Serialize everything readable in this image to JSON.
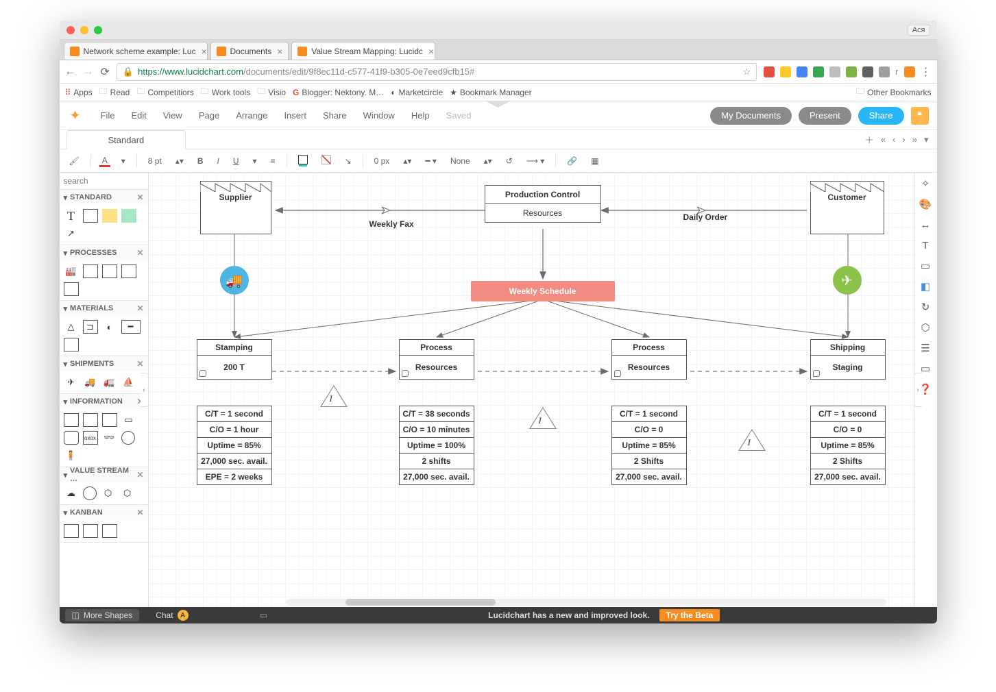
{
  "browser": {
    "user_badge": "Ася",
    "tabs": [
      {
        "title": "Network scheme example: Luc",
        "active": false
      },
      {
        "title": "Documents",
        "active": false
      },
      {
        "title": "Value Stream Mapping: Lucidc",
        "active": true
      }
    ],
    "url_secure": "https://www.lucidchart.com",
    "url_path": "/documents/edit/9f8ec11d-c577-41f9-b305-0e7eed9cfb15#",
    "bookmarks": [
      "Apps",
      "Read",
      "Competitiors",
      "Work tools",
      "Visio",
      "Blogger: Nektony. M…",
      "Marketcircle",
      "Bookmark Manager"
    ],
    "other_bookmarks": "Other Bookmarks"
  },
  "app": {
    "menu": [
      "File",
      "Edit",
      "View",
      "Page",
      "Arrange",
      "Insert",
      "Share",
      "Window",
      "Help"
    ],
    "saved": "Saved",
    "buttons": {
      "docs": "My Documents",
      "present": "Present",
      "share": "Share"
    },
    "doc_tab": "Standard",
    "toolbar": {
      "font_size": "8 pt",
      "line_width": "0 px",
      "line_style": "None"
    },
    "search_placeholder": "search"
  },
  "sidebar": {
    "sections": [
      {
        "name": "STANDARD"
      },
      {
        "name": "PROCESSES"
      },
      {
        "name": "MATERIALS"
      },
      {
        "name": "SHIPMENTS"
      },
      {
        "name": "INFORMATION"
      },
      {
        "name": "VALUE STREAM …"
      },
      {
        "name": "KANBAN"
      }
    ],
    "more_shapes": "More Shapes"
  },
  "status": {
    "chat": "Chat",
    "banner": "Lucidchart has a new and improved look.",
    "beta": "Try the Beta"
  },
  "diagram": {
    "supplier": "Supplier",
    "customer": "Customer",
    "prodctrl": {
      "title": "Production Control",
      "sub": "Resources"
    },
    "weekly_fax": "Weekly Fax",
    "daily_order": "Daily Order",
    "schedule": "Weekly Schedule",
    "processes": [
      {
        "name": "Stamping",
        "sub": "200 T",
        "data": [
          "C/T = 1 second",
          "C/O = 1 hour",
          "Uptime = 85%",
          "27,000 sec. avail.",
          "EPE = 2 weeks"
        ]
      },
      {
        "name": "Process",
        "sub": "Resources",
        "data": [
          "C/T = 38 seconds",
          "C/O = 10 minutes",
          "Uptime = 100%",
          "2 shifts",
          "27,000 sec. avail."
        ]
      },
      {
        "name": "Process",
        "sub": "Resources",
        "data": [
          "C/T = 1 second",
          "C/O = 0",
          "Uptime = 85%",
          "2 Shifts",
          "27,000 sec. avail."
        ]
      },
      {
        "name": "Shipping",
        "sub": "Staging",
        "data": [
          "C/T = 1 second",
          "C/O = 0",
          "Uptime = 85%",
          "2 Shifts",
          "27,000 sec. avail."
        ]
      }
    ]
  }
}
